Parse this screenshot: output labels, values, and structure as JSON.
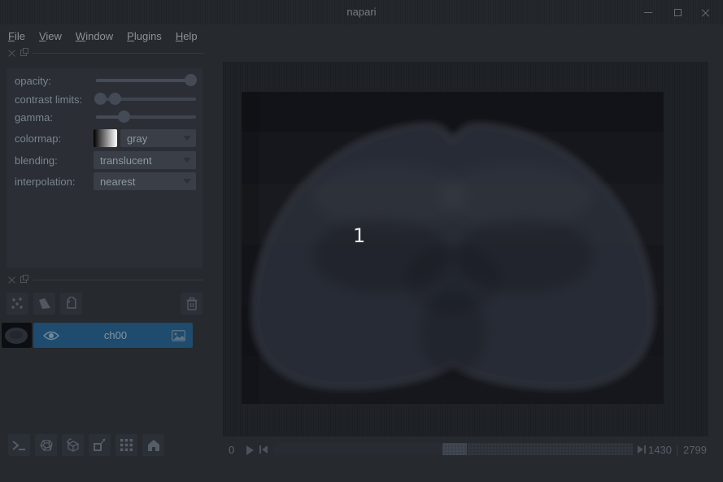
{
  "window": {
    "title": "napari"
  },
  "menu": {
    "items": [
      "File",
      "View",
      "Window",
      "Plugins",
      "Help"
    ]
  },
  "layer_controls": {
    "opacity": {
      "label": "opacity:",
      "value_pct": "94%"
    },
    "contrast_limits": {
      "label": "contrast limits:",
      "low_pct": "4%",
      "high_pct": "19%"
    },
    "gamma": {
      "label": "gamma:",
      "value_pct": "28%"
    },
    "colormap": {
      "label": "colormap:",
      "value": "gray"
    },
    "blending": {
      "label": "blending:",
      "value": "translucent"
    },
    "interpolation": {
      "label": "interpolation:",
      "value": "nearest"
    }
  },
  "layers": [
    {
      "name": "ch00",
      "selected": true,
      "visible": true
    }
  ],
  "dims": {
    "axis_label": "0",
    "current": "1430",
    "separator": "|",
    "total": "2799",
    "handle_left_pct": "47%"
  },
  "canvas": {
    "overlay_label": "1"
  },
  "colors": {
    "selection_blue": "#1e4b6e",
    "panel_bg": "#2b2e35",
    "window_bg": "#26292e",
    "canvas_bg": "#1f2227",
    "text_muted": "#79858d"
  }
}
